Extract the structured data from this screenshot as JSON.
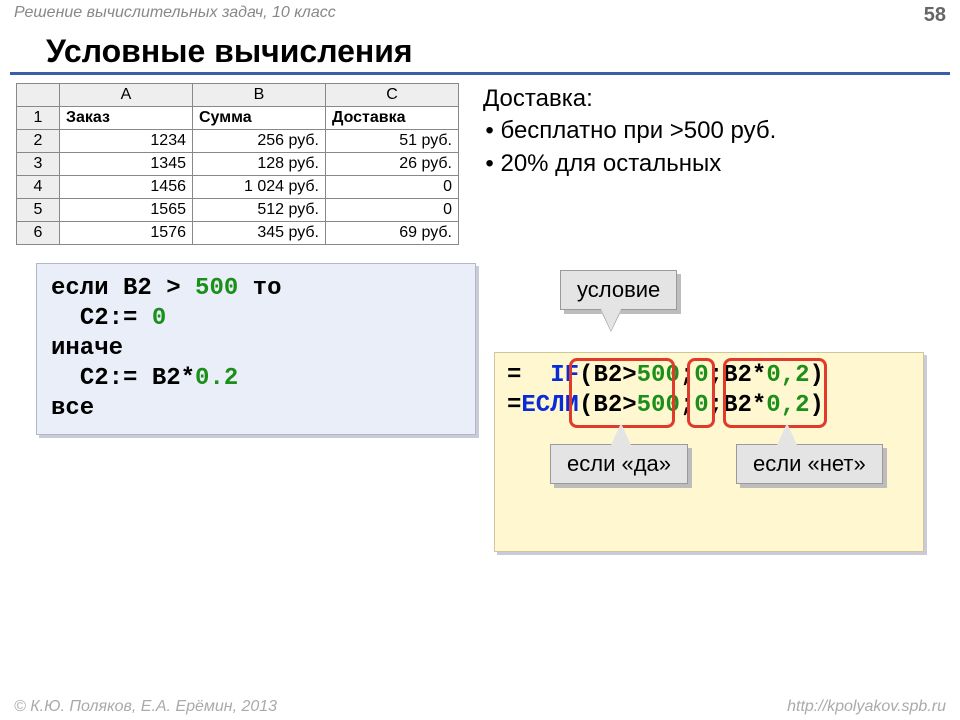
{
  "header": {
    "subject": "Решение вычислительных задач, 10 класс",
    "page": "58"
  },
  "title": "Условные вычисления",
  "sheet": {
    "cols": [
      "A",
      "B",
      "C"
    ],
    "headerRow": [
      "Заказ",
      "Сумма",
      "Доставка"
    ],
    "rows": [
      {
        "n": "2",
        "a": "1234",
        "b": "256 руб.",
        "c": "51 руб."
      },
      {
        "n": "3",
        "a": "1345",
        "b": "128 руб.",
        "c": "26 руб."
      },
      {
        "n": "4",
        "a": "1456",
        "b": "1 024 руб.",
        "c": "0"
      },
      {
        "n": "5",
        "a": "1565",
        "b": "512 руб.",
        "c": "0"
      },
      {
        "n": "6",
        "a": "1576",
        "b": "345 руб.",
        "c": "69 руб."
      }
    ]
  },
  "delivery": {
    "title": "Доставка:",
    "free": "бесплатно при >500 руб.",
    "other": "20% для остальных"
  },
  "pseudo": {
    "l1a": "если",
    "l1b": "B2",
    "l1op": ">",
    "l1num": "500",
    "l1c": "то",
    "l2a": "C2:=",
    "l2num": "0",
    "l3": "иначе",
    "l4a": "C2:=",
    "l4b": "B2*",
    "l4num": "0.2",
    "l5": "все"
  },
  "formula": {
    "eq": "=",
    "kwIF": "IF",
    "kwESLI": "ЕСЛИ",
    "lp": "(",
    "arg1": "B2>",
    "num500": "500",
    "sep": ";",
    "num0": "0",
    "arg3a": "B2*",
    "num02": "0,2",
    "rp": ")"
  },
  "callouts": {
    "cond": "условие",
    "yes": "если «да»",
    "no": "если «нет»"
  },
  "footer": {
    "left": "© К.Ю. Поляков, Е.А. Ерёмин, 2013",
    "right": "http://kpolyakov.spb.ru"
  },
  "chart_data": {
    "type": "table",
    "columns": [
      "Заказ",
      "Сумма (руб.)",
      "Доставка (руб.)"
    ],
    "rows": [
      [
        1234,
        256,
        51
      ],
      [
        1345,
        128,
        26
      ],
      [
        1456,
        1024,
        0
      ],
      [
        1565,
        512,
        0
      ],
      [
        1576,
        345,
        69
      ]
    ],
    "rule": "Доставка = 0 если Сумма > 500, иначе 20% от Суммы"
  }
}
